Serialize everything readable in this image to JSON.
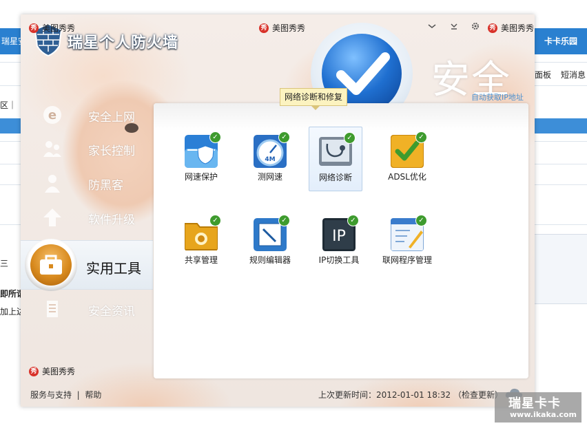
{
  "background_page": {
    "left_tab": "瑞星安",
    "right_tab": "卡卡乐园",
    "right_links": [
      "面板",
      "短消息"
    ],
    "left_fragments": [
      "区｜",
      "三",
      "即所谓",
      "加上边"
    ]
  },
  "window": {
    "title": "瑞星个人防火墙",
    "meitu_labels": [
      "美图秀秀",
      "美图秀秀",
      "美图秀秀",
      "美图秀秀"
    ],
    "meitu_badge": "秀",
    "status_big": "安全",
    "status_sub": "自动获取IP地址"
  },
  "nav": {
    "items": [
      {
        "label": "安全上网",
        "icon": "ie-icon"
      },
      {
        "label": "家长控制",
        "icon": "family-icon"
      },
      {
        "label": "防黑客",
        "icon": "hacker-icon"
      },
      {
        "label": "软件升级",
        "icon": "upgrade-arrow-icon"
      },
      {
        "label": "实用工具",
        "icon": "toolbox-icon"
      },
      {
        "label": "安全资讯",
        "icon": "news-icon"
      }
    ],
    "active": "实用工具"
  },
  "tooltip": "网络诊断和修复",
  "tools": [
    {
      "label": "网速保护",
      "icon": "speed-protect-icon"
    },
    {
      "label": "测网速",
      "icon": "speed-meter-icon"
    },
    {
      "label": "网络诊断",
      "icon": "network-diagnose-icon"
    },
    {
      "label": "ADSL优化",
      "icon": "adsl-optimize-icon"
    },
    {
      "label": "共享管理",
      "icon": "share-manage-icon"
    },
    {
      "label": "规则编辑器",
      "icon": "rule-editor-icon"
    },
    {
      "label": "IP切换工具",
      "icon": "ip-switch-icon"
    },
    {
      "label": "联网程序管理",
      "icon": "network-program-icon"
    }
  ],
  "footer": {
    "service": "服务与支持",
    "help": "帮助",
    "last_update": "上次更新时间：2012-01-01 18:32",
    "check_update": "（检查更新）"
  },
  "watermark": {
    "title": "瑞星卡卡",
    "url": "www.ikaka.com"
  },
  "colors": {
    "accent_blue": "#2a80d0",
    "check_green": "#3e9b2e",
    "tooltip_bg": "#fcf3c0",
    "status_link": "#4a90d0"
  }
}
